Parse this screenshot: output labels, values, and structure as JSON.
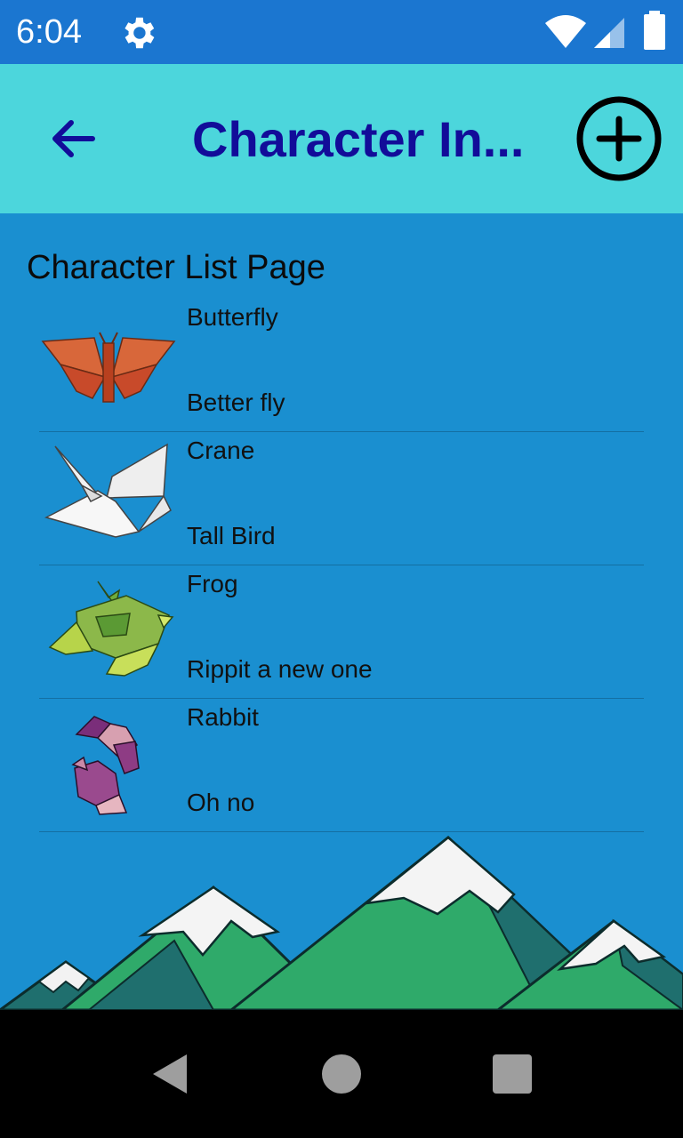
{
  "status_bar": {
    "time": "6:04",
    "icons": [
      "gear-icon",
      "wifi-icon",
      "signal-icon",
      "battery-icon"
    ]
  },
  "app_bar": {
    "title": "Character In...",
    "back_icon": "arrow-left-icon",
    "add_icon": "add-circle-icon",
    "background_color": "#4cd6dc",
    "title_color": "#120c99"
  },
  "page": {
    "heading": "Character List Page",
    "background_color": "#1a8fd0"
  },
  "characters": [
    {
      "name": "Butterfly",
      "description": "Better fly",
      "image": "origami-butterfly"
    },
    {
      "name": "Crane",
      "description": "Tall Bird",
      "image": "origami-crane"
    },
    {
      "name": "Frog",
      "description": "Rippit a new one",
      "image": "origami-frog"
    },
    {
      "name": "Rabbit",
      "description": "Oh no",
      "image": "origami-rabbit"
    }
  ],
  "nav_bar": {
    "icons": [
      "back-triangle-icon",
      "home-circle-icon",
      "recents-square-icon"
    ]
  }
}
